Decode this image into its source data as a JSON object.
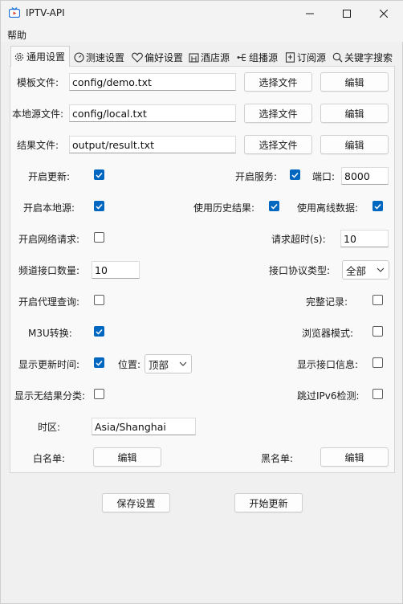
{
  "window": {
    "title": "IPTV-API"
  },
  "menu": {
    "help": "帮助"
  },
  "tabs": [
    {
      "label": "通用设置",
      "icon": "gear-icon",
      "active": true
    },
    {
      "label": "测速设置",
      "icon": "speedometer-icon"
    },
    {
      "label": "偏好设置",
      "icon": "heart-icon"
    },
    {
      "label": "酒店源",
      "icon": "hotel-icon"
    },
    {
      "label": "组播源",
      "icon": "multicast-icon"
    },
    {
      "label": "订阅源",
      "icon": "bookmark-icon"
    },
    {
      "label": "关键字搜索",
      "icon": "search-icon"
    }
  ],
  "files": {
    "template": {
      "label": "模板文件:",
      "value": "config/demo.txt"
    },
    "local": {
      "label": "本地源文件:",
      "value": "config/local.txt"
    },
    "result": {
      "label": "结果文件:",
      "value": "output/result.txt"
    },
    "choose_label": "选择文件",
    "edit_label": "编辑"
  },
  "options": {
    "open_update": {
      "label": "开启更新:",
      "checked": true
    },
    "open_service": {
      "label": "开启服务:",
      "checked": true
    },
    "port": {
      "label": "端口:",
      "value": "8000"
    },
    "open_local": {
      "label": "开启本地源:",
      "checked": true
    },
    "use_history": {
      "label": "使用历史结果:",
      "checked": true
    },
    "use_offline": {
      "label": "使用离线数据:",
      "checked": true
    },
    "open_request": {
      "label": "开启网络请求:",
      "checked": false
    },
    "request_timeout": {
      "label": "请求超时(s):",
      "value": "10"
    },
    "channel_count": {
      "label": "频道接口数量:",
      "value": "10"
    },
    "protocol_type": {
      "label": "接口协议类型:",
      "value": "全部"
    },
    "open_proxy": {
      "label": "开启代理查询:",
      "checked": false
    },
    "full_record": {
      "label": "完整记录:",
      "checked": false
    },
    "m3u": {
      "label": "M3U转换:",
      "checked": true
    },
    "browser_mode": {
      "label": "浏览器模式:",
      "checked": false
    },
    "show_update_time": {
      "label": "显示更新时间:",
      "checked": true
    },
    "position": {
      "label": "位置:",
      "value": "顶部"
    },
    "show_interface_info": {
      "label": "显示接口信息:",
      "checked": false
    },
    "show_no_result": {
      "label": "显示无结果分类:",
      "checked": false
    },
    "skip_ipv6": {
      "label": "跳过IPv6检测:",
      "checked": false
    },
    "timezone": {
      "label": "时区:",
      "value": "Asia/Shanghai"
    },
    "whitelist": {
      "label": "白名单:",
      "button": "编辑"
    },
    "blacklist": {
      "label": "黑名单:",
      "button": "编辑"
    }
  },
  "footer": {
    "save": "保存设置",
    "start": "开始更新"
  },
  "colors": {
    "accent": "#0067c0",
    "background": "#f0f0f0",
    "panel": "#f9f9f9"
  }
}
